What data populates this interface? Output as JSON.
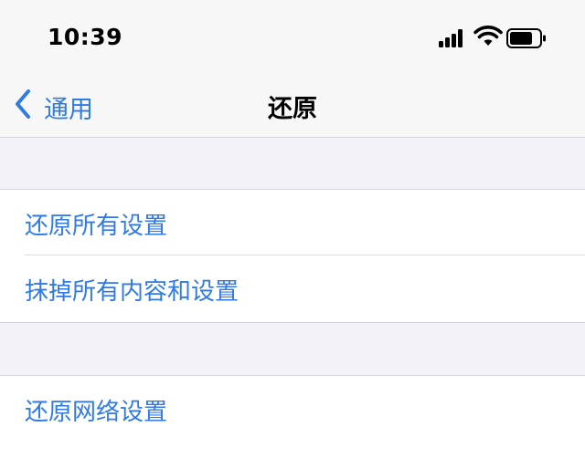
{
  "status_bar": {
    "time": "10:39",
    "icons": [
      "cellular-signal-icon",
      "wifi-icon",
      "battery-icon"
    ]
  },
  "nav": {
    "back_label": "通用",
    "title": "还原"
  },
  "groups": [
    {
      "items": [
        {
          "label": "还原所有设置"
        },
        {
          "label": "抹掉所有内容和设置"
        }
      ]
    },
    {
      "items": [
        {
          "label": "还原网络设置"
        }
      ]
    }
  ],
  "colors": {
    "accent": "#2f7ae5",
    "background": "#f2f2f7",
    "cell_background": "#ffffff",
    "separator": "#d6d6da"
  }
}
